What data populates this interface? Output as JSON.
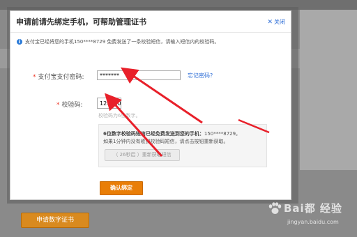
{
  "dialog": {
    "title": "申请前请先绑定手机，可帮助管理证书",
    "close_label": "关闭",
    "info_text": "支付宝已经将您的手机150****8729 免费发送了一条校验短信，请输入短信内的校验码。",
    "password_label": "支付宝支付密码:",
    "password_value": "*******",
    "forgot_password_link": "忘记密码?",
    "code_label": "校验码:",
    "code_value": "121160",
    "code_hint": "校验码为6位数字。",
    "sms_notice_line1_bold": "6位数字校验码短信已经免费发送到您的手机：",
    "sms_notice_line1_tail": "150****8729。",
    "sms_notice_line2": "如果1分钟内没有收到校验码短信，请点击按钮重新获取。",
    "resend_button": "（ 26秒后 ）重新获取短信",
    "confirm_button": "确认绑定"
  },
  "background": {
    "apply_certificate_button": "申请数字证书"
  },
  "watermark": {
    "brand_text": "Bai都 经验",
    "url": "jingyan.baidu.com"
  },
  "colors": {
    "accent_orange": "#e97e07",
    "link_blue": "#2a6bd6",
    "annotation_red": "#e8202a"
  }
}
